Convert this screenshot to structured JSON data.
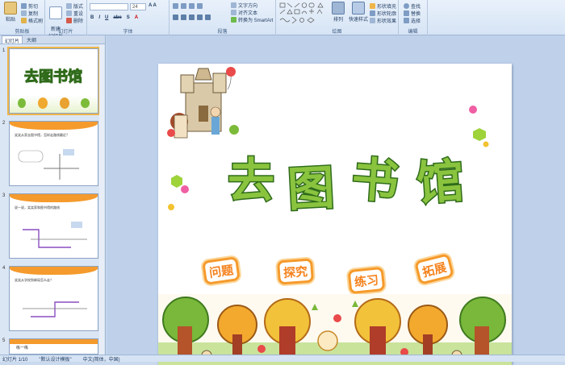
{
  "ribbon": {
    "clipboard": {
      "label": "剪贴板",
      "paste": "粘贴",
      "cut": "剪切",
      "copy": "复制",
      "format_painter": "格式刷"
    },
    "slides": {
      "label": "幻灯片",
      "new_slide": "新建\n幻灯片",
      "layout": "版式",
      "reset": "重设",
      "delete": "删除"
    },
    "font": {
      "label": "字体",
      "size": "24"
    },
    "paragraph": {
      "label": "段落",
      "text_direction": "文字方向",
      "align_text": "对齐文本",
      "smartart": "转换为 SmartArt"
    },
    "drawing": {
      "label": "绘图",
      "arrange": "排列",
      "quick_styles": "快速样式",
      "shape_fill": "形状填充",
      "shape_outline": "形状轮廓",
      "shape_effects": "形状效果"
    },
    "editing": {
      "label": "编辑",
      "find": "查找",
      "replace": "替换",
      "select": "选择"
    }
  },
  "panel": {
    "tabs": [
      "幻灯片",
      "大纲"
    ],
    "thumbs": [
      {
        "num": "1",
        "title": "去图书馆"
      },
      {
        "num": "2",
        "text": "笑笑从家去图书馆，怎样走路线最近？"
      },
      {
        "num": "3",
        "text": "说一说，笑笑家和图书馆的路线"
      },
      {
        "num": "4",
        "text": "笑笑从学校到邮局怎么走？"
      },
      {
        "num": "5",
        "text": "练一练"
      }
    ]
  },
  "slide": {
    "title_chars": [
      "去",
      "图",
      "书",
      "馆"
    ],
    "badges": [
      "问题",
      "探究",
      "练习",
      "拓展"
    ]
  },
  "status": {
    "slide_count": "幻灯片 1/10",
    "theme": "\"默认设计模板\"",
    "language": "中文(简体，中国)"
  },
  "colors": {
    "title_fill": "#8ac43f",
    "title_stroke": "#2f6b1a",
    "badge": "#f5831f",
    "thumb_header": "#f59a2c"
  }
}
